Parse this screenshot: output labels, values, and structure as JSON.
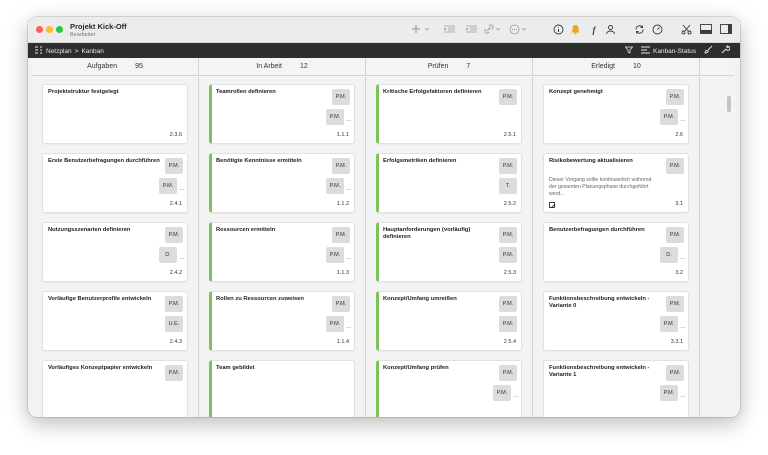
{
  "window": {
    "title": "Projekt Kick-Off",
    "subtitle": "Bearbeitet"
  },
  "toolbar": {
    "icons": [
      "plus-icon",
      "chevron-down-icon",
      "indent-icon",
      "outdent-icon",
      "link-icon",
      "chevron-down-icon",
      "more-icon",
      "chevron-down-icon",
      "info-icon",
      "bell-icon",
      "font-icon",
      "person-icon",
      "sync-icon",
      "gauge-icon",
      "scissors-icon",
      "layout-bottom-icon",
      "sidebar-icon"
    ],
    "accent_color": "#f0a020"
  },
  "navbar": {
    "breadcrumb_root": "Netzplan",
    "breadcrumb_sep": ">",
    "breadcrumb_current": "Kanban",
    "status_label": "Kanban-Status"
  },
  "columns": [
    {
      "name": "Aufgaben",
      "count": "95",
      "cards": [
        {
          "title": "Projektstruktur festgelegt",
          "id": "2.3.6"
        },
        {
          "title": "Erste Benutzerbefragungen durchführen",
          "badges": [
            "P.M.",
            "P.M."
          ],
          "more": "...",
          "id": "2.4.1"
        },
        {
          "title": "Nutzungsszenarien definieren",
          "badges": [
            "P.M.",
            "D."
          ],
          "more": "...",
          "id": "2.4.2"
        },
        {
          "title": "Vorläufige Benutzerprofile entwickeln",
          "badges": [
            "P.M.",
            "U.E."
          ],
          "id": "2.4.3"
        },
        {
          "title": "Vorläufiges Konzeptpapier entwickeln",
          "badges": [
            "P.M."
          ]
        }
      ]
    },
    {
      "name": "In Arbeit",
      "count": "12",
      "cards": [
        {
          "title": "Teamrollen definieren",
          "badges": [
            "P.M.",
            "P.M."
          ],
          "more": "...",
          "id": "1.1.1"
        },
        {
          "title": "Benötigte Kenntnisse ermitteln",
          "badges": [
            "P.M.",
            "P.M."
          ],
          "more": "...",
          "id": "1.1.2"
        },
        {
          "title": "Ressourcen ermitteln",
          "badges": [
            "P.M.",
            "P.M."
          ],
          "more": "...",
          "id": "1.1.3"
        },
        {
          "title": "Rollen zu Ressourcen zuweisen",
          "badges": [
            "P.M.",
            "P.M."
          ],
          "more": "...",
          "id": "1.1.4"
        },
        {
          "title": "Team gebildet"
        }
      ]
    },
    {
      "name": "Prüfen",
      "count": "7",
      "cards": [
        {
          "title": "Kritische Erfolgsfaktoren definieren",
          "badges": [
            "P.M."
          ],
          "id": "2.5.1"
        },
        {
          "title": "Erfolgsmetriken definieren",
          "badges": [
            "P.M.",
            "T."
          ],
          "id": "2.5.2"
        },
        {
          "title": "Hauptanforderungen (vorläufig) definieren",
          "badges": [
            "P.M.",
            "P.M."
          ],
          "id": "2.5.3"
        },
        {
          "title": "Konzept/Umfang umreißen",
          "badges": [
            "P.M.",
            "P.M."
          ],
          "id": "2.5.4"
        },
        {
          "title": "Konzept/Umfang prüfen",
          "badges": [
            "P.M.",
            "P.M."
          ],
          "more": "..."
        }
      ]
    },
    {
      "name": "Erledigt",
      "count": "10",
      "cards": [
        {
          "title": "Konzept genehmigt",
          "badges": [
            "P.M.",
            "P.M."
          ],
          "more": "...",
          "id": "2.6"
        },
        {
          "title": "Risikobewertung aktualisieren",
          "badges": [
            "P.M."
          ],
          "description": "Dieser Vorgang sollte kontinuierlich während der gesamten Planungsphase durchgeführt werd...",
          "id": "3.1"
        },
        {
          "title": "Benutzerbefragungen durchführen",
          "badges": [
            "P.M.",
            "D."
          ],
          "more": "...",
          "id": "3.2"
        },
        {
          "title": "Funktionsbeschreibung entwickeln - Variante 0",
          "badges": [
            "P.M.",
            "P.M."
          ],
          "more": "...",
          "id": "3.3.1"
        },
        {
          "title": "Funktionsbeschreibung entwickeln - Variante 1",
          "badges": [
            "P.M.",
            "P.M."
          ],
          "more": "..."
        }
      ]
    }
  ]
}
